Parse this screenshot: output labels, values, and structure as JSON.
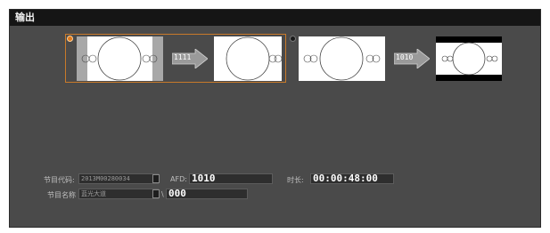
{
  "panel": {
    "title": "输出"
  },
  "options": [
    {
      "name": "option-a",
      "selected": true,
      "arrow_label": "1111"
    },
    {
      "name": "option-b",
      "selected": false,
      "arrow_label": "1010"
    }
  ],
  "fields": {
    "program_code_label": "节目代码:",
    "program_code_value": "2013M00280034",
    "afd_label": "AFD:",
    "afd_value": "1010",
    "duration_label": "时长:",
    "duration_value": "00:00:48:00",
    "program_name_label": "节目名称",
    "program_name_value": "蓝光大道",
    "suffix_label": "\\",
    "suffix_value": "000"
  },
  "colors": {
    "accent": "#e07a1c",
    "panel_bg": "#4a4a4a",
    "titlebar_bg": "#151515"
  }
}
